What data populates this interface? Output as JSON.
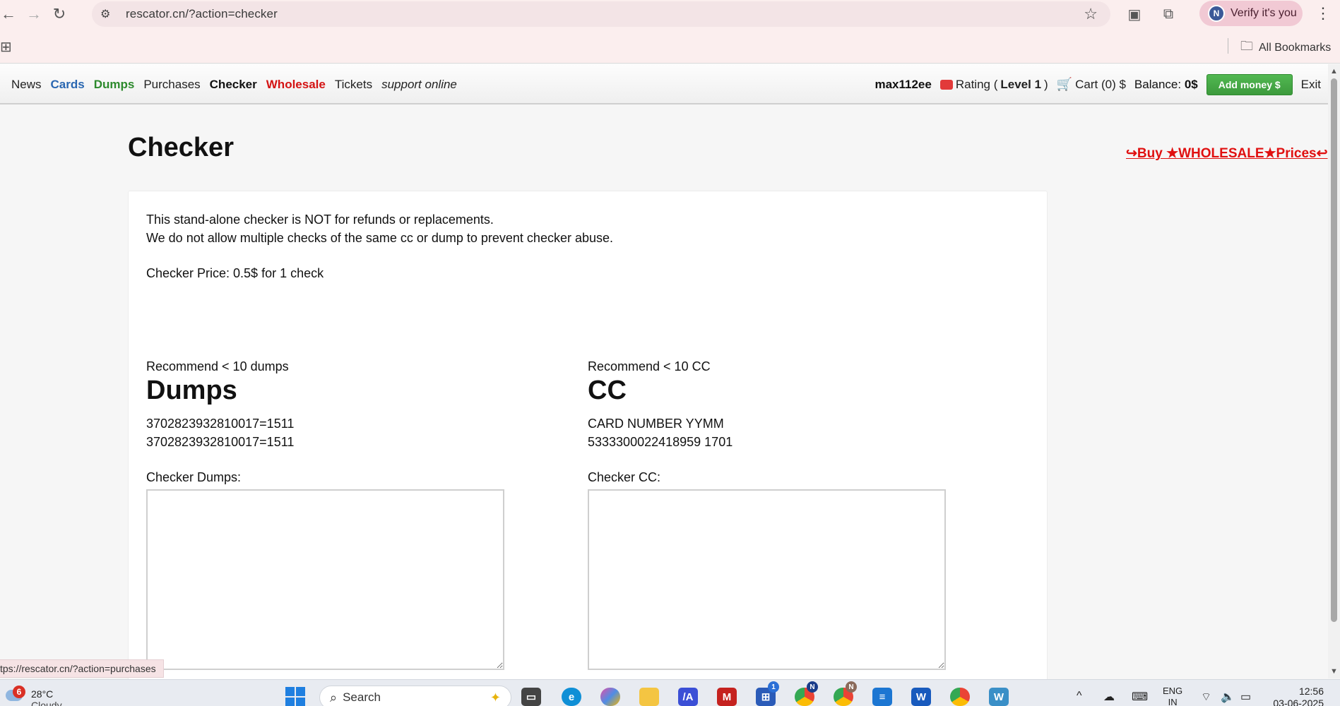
{
  "browser": {
    "url": "rescator.cn/?action=checker",
    "verify_label": "Verify it's you",
    "profile_initial": "N",
    "all_bookmarks": "All Bookmarks"
  },
  "site_nav": {
    "links": [
      "News",
      "Cards",
      "Dumps",
      "Purchases",
      "Checker",
      "Wholesale",
      "Tickets",
      "support online"
    ],
    "username": "max112ee",
    "rating_prefix": "Rating (",
    "rating_level": "Level 1",
    "rating_suffix": ")",
    "cart": "Cart (0) $",
    "balance_label": "Balance:",
    "balance_value": "0$",
    "add_money": "Add money $",
    "exit": "Exit"
  },
  "page": {
    "title": "Checker",
    "wholesale_link": "↪Buy ★WHOLESALE★Prices↩",
    "notice_line1": "This stand-alone checker is NOT for refunds or replacements.",
    "notice_line2": "We do not allow multiple checks of the same cc or dump to prevent checker abuse.",
    "price": "Checker Price: 0.5$ for 1 check",
    "dumps": {
      "recommend": "Recommend < 10 dumps",
      "title": "Dumps",
      "example1": "3702823932810017=1511",
      "example2": "3702823932810017=1511",
      "label": "Checker Dumps:"
    },
    "cc": {
      "recommend": "Recommend < 10 CC",
      "title": "CC",
      "example1": "CARD NUMBER YYMM",
      "example2": "5333300022418959 1701",
      "label": "Checker CC:"
    }
  },
  "status_bar_url": "tps://rescator.cn/?action=purchases",
  "taskbar": {
    "weather_badge": "6",
    "temperature": "28°C",
    "condition": "Cloudy",
    "search_label": "Search",
    "store_badge": "1",
    "chrome_badge_1": "N",
    "chrome_badge_2": "N",
    "lang_line1": "ENG",
    "lang_line2": "IN",
    "time": "12:56",
    "date": "03-06-2025"
  }
}
